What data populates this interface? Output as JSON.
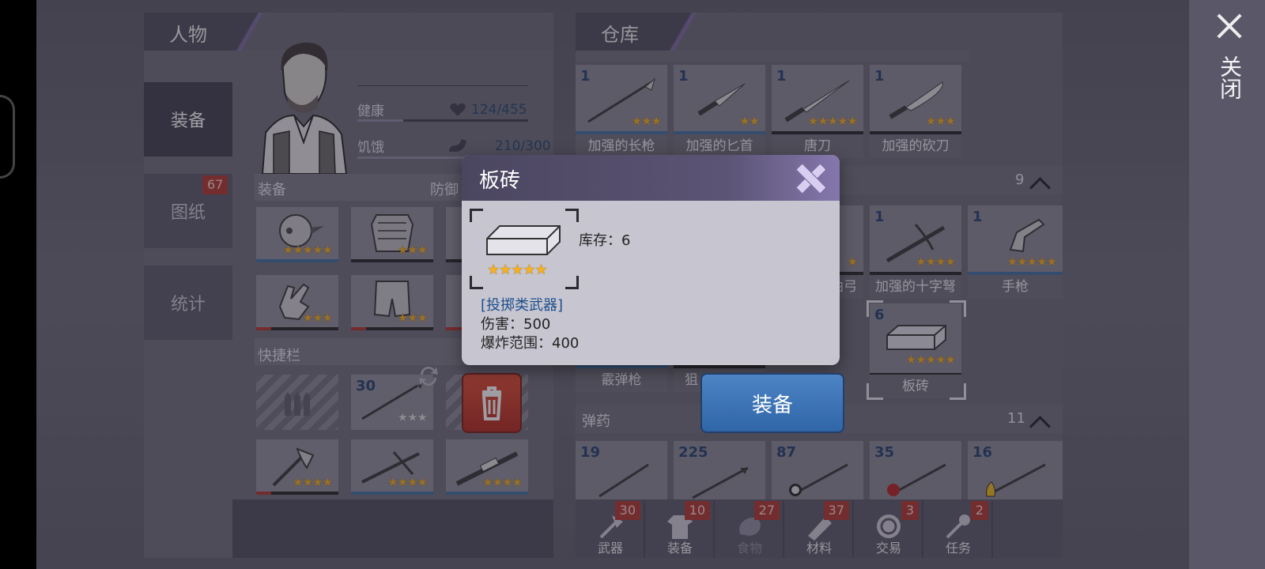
{
  "side": {
    "close_label": "关闭"
  },
  "character": {
    "panel_title": "人物",
    "tabs": [
      {
        "label": "装备",
        "active": true
      },
      {
        "label": "图纸",
        "badge": "67"
      },
      {
        "label": "统计"
      }
    ],
    "stats": {
      "health_label": "健康",
      "health_value": "124/455",
      "health_fraction": 0.27,
      "hunger_label": "饥饿",
      "hunger_value": "210/300",
      "hunger_fraction": 0.7
    },
    "equipment_title": "装备",
    "defense_label": "防御",
    "quickbar_title": "快捷栏",
    "quickbar_count": "30"
  },
  "warehouse": {
    "panel_title": "仓库",
    "top_row": [
      {
        "count": "1",
        "name": "加强的长枪",
        "stars": "★★★"
      },
      {
        "count": "1",
        "name": "加强的匕首",
        "stars": "★★"
      },
      {
        "count": "1",
        "name": "唐刀",
        "stars": "★★★★★"
      },
      {
        "count": "1",
        "name": "加强的砍刀",
        "stars": "★★★"
      }
    ],
    "ranged_count": "9",
    "mid_row": [
      {
        "count": "1",
        "name": "加强的十字弩",
        "stars": "★★★★"
      },
      {
        "count": "1",
        "name": "手枪",
        "stars": "★★★★★"
      }
    ],
    "partial_names": {
      "bow": "曲弓",
      "shotgun": "霰弹枪",
      "sniper": "狙"
    },
    "brick_item": {
      "count": "6",
      "name": "板砖",
      "stars": "★★★★★"
    },
    "ammo_title": "弹药",
    "ammo_count": "11",
    "ammo_counts": [
      "19",
      "225",
      "87",
      "35",
      "16"
    ],
    "equip_button": "装备",
    "bottom_tabs": [
      {
        "label": "武器",
        "badge": "30"
      },
      {
        "label": "装备",
        "badge": "10"
      },
      {
        "label": "食物",
        "badge": "27"
      },
      {
        "label": "材料",
        "badge": "37"
      },
      {
        "label": "交易",
        "badge": "3"
      },
      {
        "label": "任务",
        "badge": "2"
      }
    ]
  },
  "dialog": {
    "title": "板砖",
    "stock": "库存：6",
    "category": "[投掷类武器]",
    "damage": "伤害：500",
    "blast": "爆炸范围：400",
    "stars": "★★★★★"
  }
}
